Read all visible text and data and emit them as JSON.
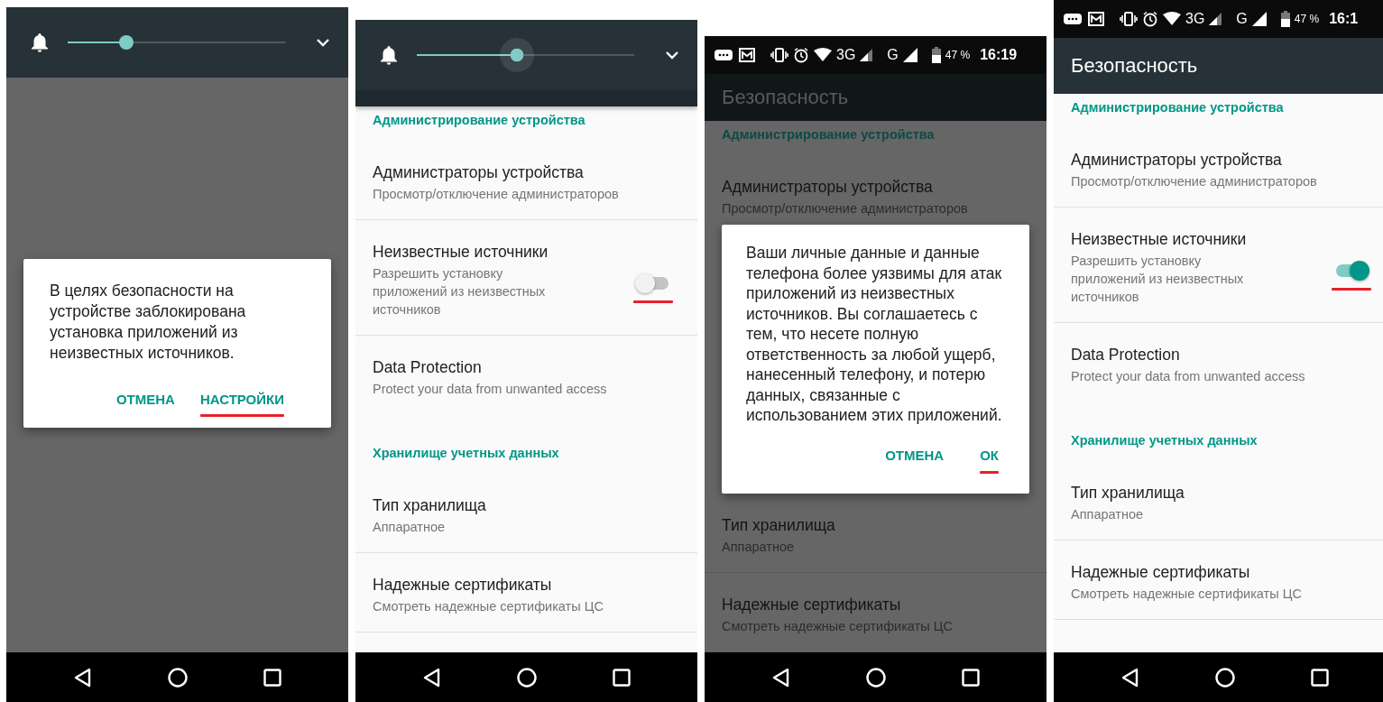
{
  "screens": [
    {
      "kind": "volume_dialog",
      "volume": {
        "level": 0.27,
        "pressed": false
      },
      "dialog": {
        "message": "В целях безопасности на устройстве заблокирована установка приложений из неизвестных источников.",
        "buttons": [
          {
            "label": "ОТМЕНА",
            "underlined": false
          },
          {
            "label": "НАСТРОЙКИ",
            "underlined": true
          }
        ]
      }
    },
    {
      "kind": "volume_settings",
      "volume": {
        "level": 0.46,
        "pressed": true
      },
      "dimmed": false,
      "list": [
        {
          "kind": "header",
          "title": "Администрирование устройства"
        },
        {
          "kind": "item",
          "title": "Администраторы устройства",
          "summary": "Просмотр/отключение администраторов"
        },
        {
          "kind": "switch",
          "title": "Неизвестные источники",
          "summary": "Разрешить установку приложений из неизвестных источников",
          "on": false,
          "underlined": true
        },
        {
          "kind": "item",
          "title": "Data Protection",
          "summary": "Protect your data from unwanted access"
        },
        {
          "kind": "header",
          "title": "Хранилище учетных данных"
        },
        {
          "kind": "item",
          "title": "Тип хранилища",
          "summary": "Аппаратное"
        },
        {
          "kind": "item",
          "title": "Надежные сертификаты",
          "summary": "Смотреть надежные сертификаты ЦС"
        }
      ]
    },
    {
      "kind": "settings",
      "status_bar": {
        "network_1": "3G",
        "network_2": "G",
        "battery": "47 %",
        "time": "16:19"
      },
      "title": "Безопасность",
      "dimmed": true,
      "list": [
        {
          "kind": "header",
          "title": "Администрирование устройства"
        },
        {
          "kind": "item",
          "title": "Администраторы устройства",
          "summary": "Просмотр/отключение администраторов"
        }
      ],
      "dialog": {
        "message": "Ваши личные данные и данные телефона более уязвимы для атак приложений из неизвестных источников. Вы соглашаетесь с тем, что несете полную ответственность за любой ущерб, нанесенный телефону, и потерю данных, связанные с использованием этих приложений.",
        "buttons": [
          {
            "label": "ОТМЕНА",
            "underlined": false
          },
          {
            "label": "ОК",
            "underlined": true
          }
        ]
      },
      "list_below": [
        {
          "kind": "item",
          "title": "Тип хранилища",
          "summary": "Аппаратное"
        },
        {
          "kind": "item",
          "title": "Надежные сертификаты",
          "summary": "Смотреть надежные сертификаты ЦС"
        }
      ]
    },
    {
      "kind": "settings",
      "status_bar": {
        "network_1": "3G",
        "network_2": "G",
        "battery": "47 %",
        "time": "16:1"
      },
      "title": "Безопасность",
      "dimmed": false,
      "list": [
        {
          "kind": "header",
          "title": "Администрирование устройства"
        },
        {
          "kind": "item",
          "title": "Администраторы устройства",
          "summary": "Просмотр/отключение администраторов"
        },
        {
          "kind": "switch",
          "title": "Неизвестные источники",
          "summary": "Разрешить установку приложений из неизвестных источников",
          "on": true,
          "underlined": true
        },
        {
          "kind": "item",
          "title": "Data Protection",
          "summary": "Protect your data from unwanted access"
        },
        {
          "kind": "header",
          "title": "Хранилище учетных данных"
        },
        {
          "kind": "item",
          "title": "Тип хранилища",
          "summary": "Аппаратное"
        },
        {
          "kind": "item",
          "title": "Надежные сертификаты",
          "summary": "Смотреть надежные сертификаты ЦС"
        }
      ]
    }
  ]
}
